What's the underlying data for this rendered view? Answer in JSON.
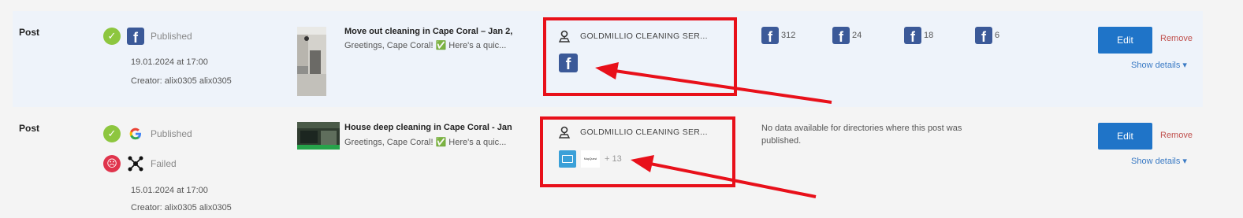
{
  "posts": [
    {
      "type": "Post",
      "channels": [
        {
          "network": "facebook",
          "status": "Published"
        }
      ],
      "date": "19.01.2024 at 17:00",
      "creator": "Creator: alix0305 alix0305",
      "title": "Move out cleaning in Cape Coral – Jan 2,",
      "excerpt": "Greetings, Cape Coral! ✅ Here's a quic...",
      "location": "GOLDMILLIO CLEANING SER...",
      "stats": [
        "312",
        "24",
        "18",
        "6"
      ],
      "edit": "Edit",
      "remove": "Remove",
      "details": "Show details ▾"
    },
    {
      "type": "Post",
      "channels": [
        {
          "network": "google",
          "status": "Published"
        },
        {
          "network": "other",
          "status": "Failed"
        }
      ],
      "date": "15.01.2024 at 17:00",
      "creator": "Creator: alix0305 alix0305",
      "title": "House deep cleaning in Cape Coral - Jan",
      "excerpt": "Greetings, Cape Coral! ✅ Here's a quic...",
      "location": "GOLDMILLIO CLEANING SER...",
      "dir_more": "+ 13",
      "dir_logo_text": "MapQuest",
      "no_data": "No data available for directories where this post was published.",
      "edit": "Edit",
      "remove": "Remove",
      "details": "Show details ▾"
    }
  ],
  "colors": {
    "highlight": "#e8101a",
    "accent": "#1f74c8",
    "ok": "#8dc63f",
    "fail": "#e0344c"
  }
}
